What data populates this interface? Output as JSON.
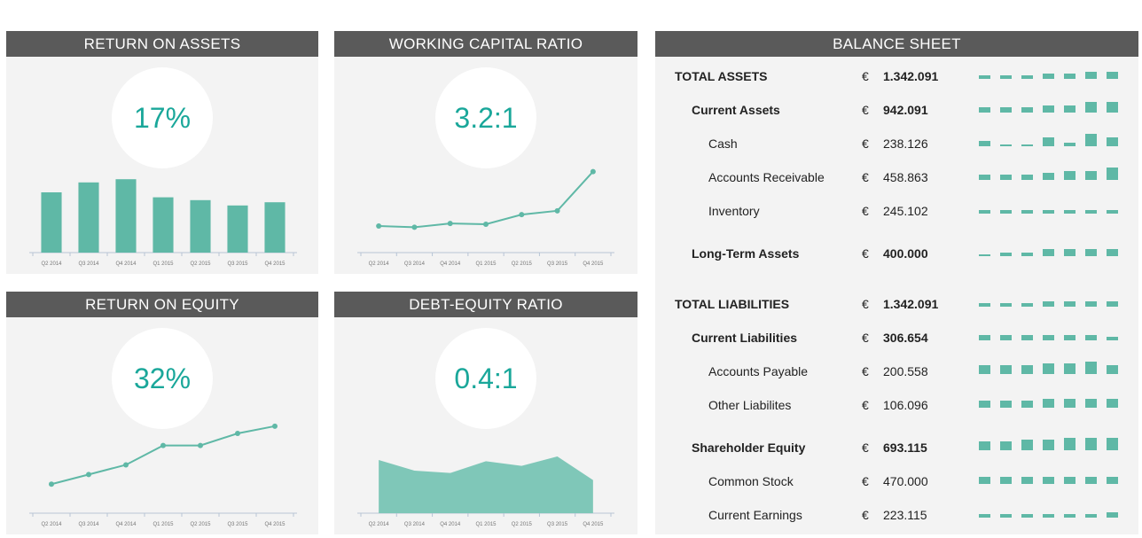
{
  "colors": {
    "accent": "#1aa79a",
    "mark": "#5fb8a6",
    "area": "#7fc7b8",
    "header": "#5a5a5a",
    "panel": "#f3f3f3"
  },
  "panels": {
    "roa": {
      "title": "RETURN ON ASSETS",
      "kpi": "17%"
    },
    "wcr": {
      "title": "WORKING CAPITAL RATIO",
      "kpi": "3.2:1"
    },
    "roe": {
      "title": "RETURN ON EQUITY",
      "kpi": "32%"
    },
    "der": {
      "title": "DEBT-EQUITY RATIO",
      "kpi": "0.4:1"
    },
    "bs": {
      "title": "BALANCE SHEET"
    }
  },
  "chart_data": [
    {
      "id": "roa",
      "type": "bar",
      "categories": [
        "Q2 2014",
        "Q3 2014",
        "Q4 2014",
        "Q1 2015",
        "Q2 2015",
        "Q3 2015",
        "Q4 2015"
      ],
      "values": [
        17.0,
        19.8,
        20.7,
        15.6,
        14.8,
        13.3,
        14.2
      ],
      "ylim": [
        0,
        22
      ]
    },
    {
      "id": "wcr",
      "type": "line",
      "categories": [
        "Q2 2014",
        "Q3 2014",
        "Q4 2014",
        "Q1 2015",
        "Q2 2015",
        "Q3 2015",
        "Q4 2015"
      ],
      "values": [
        1.05,
        1.0,
        1.15,
        1.12,
        1.5,
        1.65,
        3.2
      ],
      "ylim": [
        0,
        4.2
      ]
    },
    {
      "id": "roe",
      "type": "line",
      "categories": [
        "Q2 2014",
        "Q3 2014",
        "Q4 2014",
        "Q1 2015",
        "Q2 2015",
        "Q3 2015",
        "Q4 2015"
      ],
      "values": [
        12,
        16,
        20,
        28,
        28,
        33,
        36
      ],
      "ylim": [
        0,
        44
      ]
    },
    {
      "id": "der",
      "type": "area",
      "categories": [
        "Q2 2014",
        "Q3 2014",
        "Q4 2014",
        "Q1 2015",
        "Q2 2015",
        "Q3 2015",
        "Q4 2015"
      ],
      "values": [
        0.45,
        0.36,
        0.34,
        0.44,
        0.4,
        0.48,
        0.28
      ],
      "ylim": [
        0,
        0.9
      ]
    },
    {
      "id": "balance-sheet",
      "type": "table",
      "currency": "€",
      "rows": [
        {
          "label": "TOTAL ASSETS",
          "value": "1.342.091",
          "level": 0,
          "bold": true,
          "spark": [
            2,
            2,
            2,
            3,
            3,
            4,
            4
          ]
        },
        {
          "label": "Current Assets",
          "value": "942.091",
          "level": 1,
          "bold": true,
          "spark": [
            3,
            3,
            3,
            4,
            4,
            6,
            6
          ]
        },
        {
          "label": "Cash",
          "value": "238.126",
          "level": 2,
          "bold": false,
          "spark": [
            3,
            1,
            1,
            5,
            2,
            8,
            5
          ]
        },
        {
          "label": "Accounts Receivable",
          "value": "458.863",
          "level": 2,
          "bold": false,
          "spark": [
            3,
            3,
            3,
            4,
            5,
            5,
            7
          ]
        },
        {
          "label": "Inventory",
          "value": "245.102",
          "level": 2,
          "bold": false,
          "spark": [
            2,
            2,
            2,
            2,
            2,
            2,
            2
          ]
        },
        {
          "label": "Long-Term Assets",
          "value": "400.000",
          "level": 1,
          "bold": true,
          "spark": [
            1,
            2,
            2,
            4,
            4,
            4,
            4
          ]
        },
        {
          "label": "TOTAL LIABILITIES",
          "value": "1.342.091",
          "level": 0,
          "bold": true,
          "spark": [
            2,
            2,
            2,
            3,
            3,
            3,
            3
          ]
        },
        {
          "label": "Current Liabilities",
          "value": "306.654",
          "level": 1,
          "bold": true,
          "spark": [
            3,
            3,
            3,
            3,
            3,
            3,
            2
          ]
        },
        {
          "label": "Accounts Payable",
          "value": "200.558",
          "level": 2,
          "bold": false,
          "spark": [
            5,
            5,
            5,
            6,
            6,
            8,
            5
          ]
        },
        {
          "label": "Other Liabilites",
          "value": "106.096",
          "level": 2,
          "bold": false,
          "spark": [
            4,
            4,
            4,
            5,
            5,
            5,
            5
          ]
        },
        {
          "label": "Shareholder Equity",
          "value": "693.115",
          "level": 1,
          "bold": true,
          "spark": [
            5,
            5,
            6,
            6,
            7,
            7,
            8
          ]
        },
        {
          "label": "Common Stock",
          "value": "470.000",
          "level": 2,
          "bold": false,
          "spark": [
            4,
            4,
            4,
            4,
            4,
            4,
            4
          ]
        },
        {
          "label": "Current Earnings",
          "value": "223.115",
          "level": 2,
          "bold": false,
          "spark": [
            2,
            2,
            2,
            2,
            2,
            2,
            3
          ]
        }
      ]
    }
  ]
}
